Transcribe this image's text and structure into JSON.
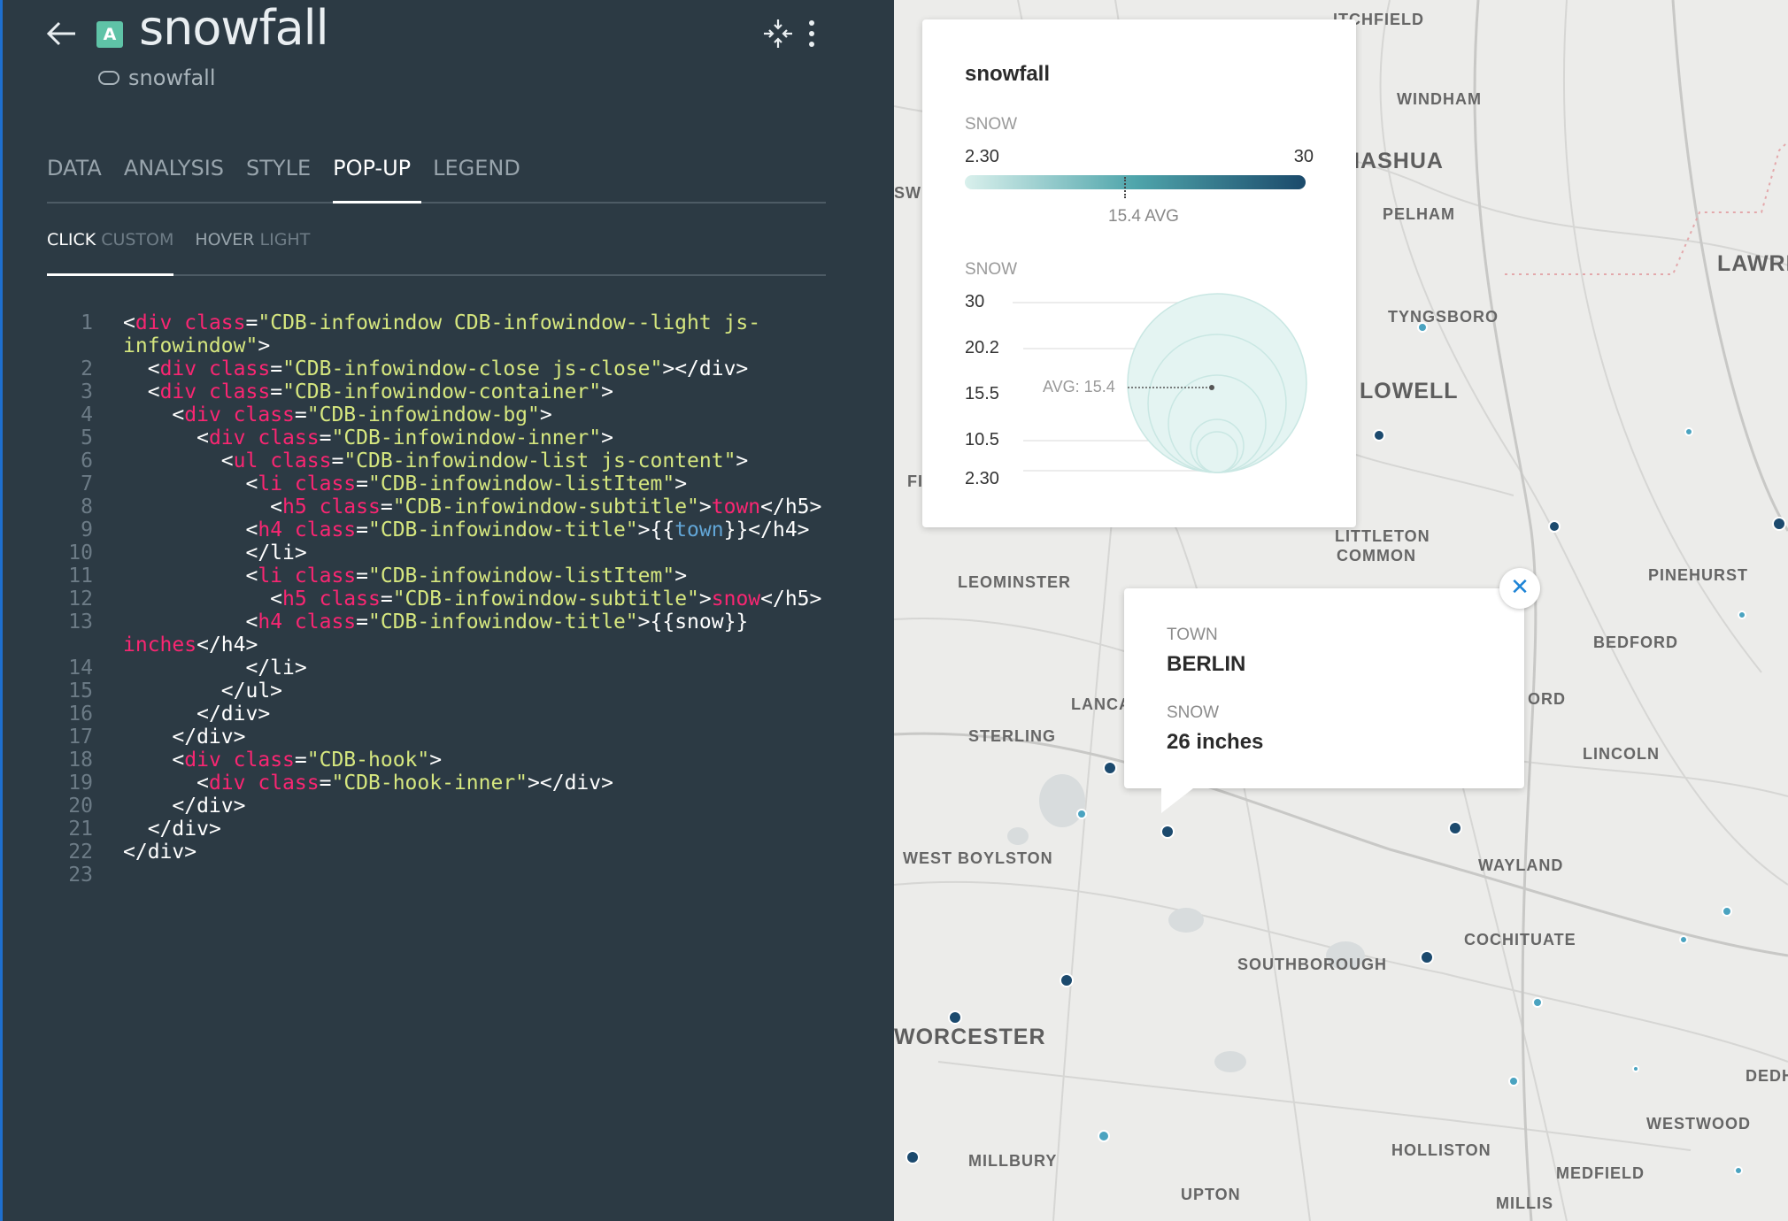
{
  "header": {
    "layer_badge": "A",
    "title": "snowfall",
    "source": "snowfall",
    "icons": [
      "back-arrow-icon",
      "collapse-icon",
      "more-vertical-icon",
      "dataset-icon"
    ]
  },
  "tabs": [
    "DATA",
    "ANALYSIS",
    "STYLE",
    "POP-UP",
    "LEGEND"
  ],
  "active_tab": "POP-UP",
  "subtabs": [
    {
      "label": "CLICK",
      "value": "CUSTOM",
      "active": true
    },
    {
      "label": "HOVER",
      "value": "LIGHT",
      "active": false
    }
  ],
  "code_lines": [
    {
      "n": "1",
      "parts": [
        [
          "t",
          "<"
        ],
        [
          "g",
          "div"
        ],
        [
          "t",
          " "
        ],
        [
          "a",
          "class"
        ],
        [
          "t",
          "="
        ],
        [
          "s",
          "\"CDB-infowindow CDB-infowindow--light js-infowindow\""
        ],
        [
          "t",
          ">"
        ]
      ]
    },
    {
      "n": "2",
      "parts": [
        [
          "t",
          "  <"
        ],
        [
          "g",
          "div"
        ],
        [
          "t",
          " "
        ],
        [
          "a",
          "class"
        ],
        [
          "t",
          "="
        ],
        [
          "s",
          "\"CDB-infowindow-close js-close\""
        ],
        [
          "t",
          "></div>"
        ]
      ]
    },
    {
      "n": "3",
      "parts": [
        [
          "t",
          "  <"
        ],
        [
          "g",
          "div"
        ],
        [
          "t",
          " "
        ],
        [
          "a",
          "class"
        ],
        [
          "t",
          "="
        ],
        [
          "s",
          "\"CDB-infowindow-container\""
        ],
        [
          "t",
          ">"
        ]
      ]
    },
    {
      "n": "4",
      "parts": [
        [
          "t",
          "    <"
        ],
        [
          "g",
          "div"
        ],
        [
          "t",
          " "
        ],
        [
          "a",
          "class"
        ],
        [
          "t",
          "="
        ],
        [
          "s",
          "\"CDB-infowindow-bg\""
        ],
        [
          "t",
          ">"
        ]
      ]
    },
    {
      "n": "5",
      "parts": [
        [
          "t",
          "      <"
        ],
        [
          "g",
          "div"
        ],
        [
          "t",
          " "
        ],
        [
          "a",
          "class"
        ],
        [
          "t",
          "="
        ],
        [
          "s",
          "\"CDB-infowindow-inner\""
        ],
        [
          "t",
          ">"
        ]
      ]
    },
    {
      "n": "6",
      "parts": [
        [
          "t",
          "        <"
        ],
        [
          "g",
          "ul"
        ],
        [
          "t",
          " "
        ],
        [
          "a",
          "class"
        ],
        [
          "t",
          "="
        ],
        [
          "s",
          "\"CDB-infowindow-list js-content\""
        ],
        [
          "t",
          ">"
        ]
      ]
    },
    {
      "n": "7",
      "parts": [
        [
          "t",
          "          <"
        ],
        [
          "g",
          "li"
        ],
        [
          "t",
          " "
        ],
        [
          "a",
          "class"
        ],
        [
          "t",
          "="
        ],
        [
          "s",
          "\"CDB-infowindow-listItem\""
        ],
        [
          "t",
          ">"
        ]
      ]
    },
    {
      "n": "8",
      "parts": [
        [
          "t",
          "            <"
        ],
        [
          "g",
          "h5"
        ],
        [
          "t",
          " "
        ],
        [
          "a",
          "class"
        ],
        [
          "t",
          "="
        ],
        [
          "s",
          "\"CDB-infowindow-subtitle\""
        ],
        [
          "t",
          ">"
        ],
        [
          "g",
          "town"
        ],
        [
          "t",
          "</h5>"
        ]
      ]
    },
    {
      "n": "9",
      "parts": [
        [
          "t",
          "          <"
        ],
        [
          "g",
          "h4"
        ],
        [
          "t",
          " "
        ],
        [
          "a",
          "class"
        ],
        [
          "t",
          "="
        ],
        [
          "s",
          "\"CDB-infowindow-title\""
        ],
        [
          "t",
          ">{{"
        ],
        [
          "p",
          "town"
        ],
        [
          "t",
          "}}</h4>"
        ]
      ]
    },
    {
      "n": "10",
      "parts": [
        [
          "t",
          "          </li>"
        ]
      ]
    },
    {
      "n": "11",
      "parts": [
        [
          "t",
          "          <"
        ],
        [
          "g",
          "li"
        ],
        [
          "t",
          " "
        ],
        [
          "a",
          "class"
        ],
        [
          "t",
          "="
        ],
        [
          "s",
          "\"CDB-infowindow-listItem\""
        ],
        [
          "t",
          ">"
        ]
      ]
    },
    {
      "n": "12",
      "parts": [
        [
          "t",
          "            <"
        ],
        [
          "g",
          "h5"
        ],
        [
          "t",
          " "
        ],
        [
          "a",
          "class"
        ],
        [
          "t",
          "="
        ],
        [
          "s",
          "\"CDB-infowindow-subtitle\""
        ],
        [
          "t",
          ">"
        ],
        [
          "g",
          "snow"
        ],
        [
          "t",
          "</h5>"
        ]
      ]
    },
    {
      "n": "13",
      "parts": [
        [
          "t",
          "          <"
        ],
        [
          "g",
          "h4"
        ],
        [
          "t",
          " "
        ],
        [
          "a",
          "class"
        ],
        [
          "t",
          "="
        ],
        [
          "s",
          "\"CDB-infowindow-title\""
        ],
        [
          "t",
          ">{{snow}} "
        ],
        [
          "g",
          "inches"
        ],
        [
          "t",
          "</h4>"
        ]
      ]
    },
    {
      "n": "14",
      "parts": [
        [
          "t",
          "          </li>"
        ]
      ]
    },
    {
      "n": "15",
      "parts": [
        [
          "t",
          "        </ul>"
        ]
      ]
    },
    {
      "n": "16",
      "parts": [
        [
          "t",
          "      </div>"
        ]
      ]
    },
    {
      "n": "17",
      "parts": [
        [
          "t",
          "    </div>"
        ]
      ]
    },
    {
      "n": "18",
      "parts": [
        [
          "t",
          "    <"
        ],
        [
          "g",
          "div"
        ],
        [
          "t",
          " "
        ],
        [
          "a",
          "class"
        ],
        [
          "t",
          "="
        ],
        [
          "s",
          "\"CDB-hook\""
        ],
        [
          "t",
          ">"
        ]
      ]
    },
    {
      "n": "19",
      "parts": [
        [
          "t",
          "      <"
        ],
        [
          "g",
          "div"
        ],
        [
          "t",
          " "
        ],
        [
          "a",
          "class"
        ],
        [
          "t",
          "="
        ],
        [
          "s",
          "\"CDB-hook-inner\""
        ],
        [
          "t",
          "></div>"
        ]
      ]
    },
    {
      "n": "20",
      "parts": [
        [
          "t",
          "    </div>"
        ]
      ]
    },
    {
      "n": "21",
      "parts": [
        [
          "t",
          "  </div>"
        ]
      ]
    },
    {
      "n": "22",
      "parts": [
        [
          "t",
          "</div>"
        ]
      ]
    },
    {
      "n": "23",
      "parts": [
        [
          "t",
          ""
        ]
      ]
    }
  ],
  "legend": {
    "title": "snowfall",
    "gradient": {
      "label": "SNOW",
      "min": "2.30",
      "max": "30",
      "avg_label": "15.4 AVG",
      "avg_value": 15.4
    },
    "bubbles": {
      "label": "SNOW",
      "ticks": [
        "30",
        "20.2",
        "15.5",
        "10.5",
        "2.30"
      ],
      "avg_label": "AVG: 15.4"
    }
  },
  "popup": {
    "fields": [
      {
        "key": "TOWN",
        "value": "BERLIN"
      },
      {
        "key": "SNOW",
        "value": "26 inches"
      }
    ],
    "close_icon": "close-icon"
  },
  "map_places": [
    {
      "name": "ITCHFIELD",
      "size": "small"
    },
    {
      "name": "WINDHAM",
      "size": "small"
    },
    {
      "name": "NASHUA",
      "size": "big"
    },
    {
      "name": "PELHAM",
      "size": "small"
    },
    {
      "name": "LAWRE",
      "size": "big"
    },
    {
      "name": "TYNGSBORO",
      "size": "small"
    },
    {
      "name": "LOWELL",
      "size": "big"
    },
    {
      "name": "LITTLETON",
      "size": "small"
    },
    {
      "name": "COMMON",
      "size": "small"
    },
    {
      "name": "LEOMINSTER",
      "size": "small"
    },
    {
      "name": "PINEHURST",
      "size": "small"
    },
    {
      "name": "BEDFORD",
      "size": "small"
    },
    {
      "name": "ORD",
      "size": "small"
    },
    {
      "name": "LANCA",
      "size": "small"
    },
    {
      "name": "STERLING",
      "size": "small"
    },
    {
      "name": "LINCOLN",
      "size": "small"
    },
    {
      "name": "WEST BOYLSTON",
      "size": "small"
    },
    {
      "name": "WAYLAND",
      "size": "small"
    },
    {
      "name": "COCHITUATE",
      "size": "small"
    },
    {
      "name": "SOUTHBOROUGH",
      "size": "small"
    },
    {
      "name": "WORCESTER",
      "size": "big"
    },
    {
      "name": "DEDH",
      "size": "small"
    },
    {
      "name": "WESTWOOD",
      "size": "small"
    },
    {
      "name": "HOLLISTON",
      "size": "small"
    },
    {
      "name": "MILLBURY",
      "size": "small"
    },
    {
      "name": "MEDFIELD",
      "size": "small"
    },
    {
      "name": "UPTON",
      "size": "small"
    },
    {
      "name": "MILLIS",
      "size": "small"
    },
    {
      "name": "SWI",
      "size": "small"
    },
    {
      "name": "FI",
      "size": "small"
    }
  ],
  "colors": {
    "panel_bg": "#2c3a44",
    "accent": "#1e6fcf",
    "code_tag": "#f92672",
    "code_string": "#d6e77f",
    "code_placeholder": "#62a6d7",
    "point_dark": "#1c4a6e",
    "point_light": "#4aa3c0"
  }
}
